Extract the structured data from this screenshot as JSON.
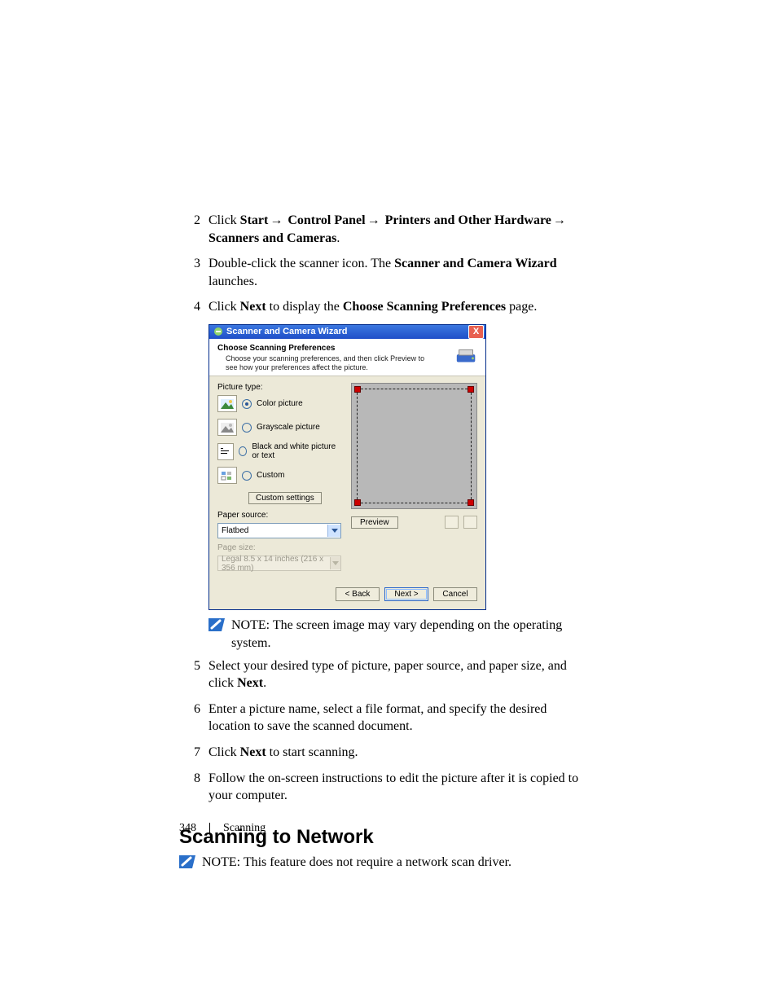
{
  "steps_top": {
    "s2": {
      "num": "2",
      "pre": "Click ",
      "b1": "Start",
      "a1": "→ ",
      "b2": "Control Panel",
      "a2": "→ ",
      "b3": "Printers and Other Hardware",
      "a3": "→ ",
      "b4": "Scanners and Cameras",
      "post": "."
    },
    "s3": {
      "num": "3",
      "pre": "Double-click the scanner icon. The ",
      "b1": "Scanner and Camera Wizard",
      "post": " launches."
    },
    "s4": {
      "num": "4",
      "pre": "Click ",
      "b1": "Next",
      "mid": " to display the ",
      "b2": "Choose Scanning Preferences",
      "post": " page."
    }
  },
  "wizard": {
    "title": "Scanner and Camera Wizard",
    "head_bold": "Choose Scanning Preferences",
    "head_sub": "Choose your scanning preferences, and then click Preview to see how your preferences affect the picture.",
    "picture_type_label": "Picture type:",
    "opt_color": "Color picture",
    "opt_gray": "Grayscale picture",
    "opt_bw": "Black and white picture or text",
    "opt_custom": "Custom",
    "custom_settings": "Custom settings",
    "paper_source_label": "Paper source:",
    "paper_source_value": "Flatbed",
    "page_size_label": "Page size:",
    "page_size_value": "Legal 8.5 x 14 inches (216 x 356 mm)",
    "preview_btn": "Preview",
    "back": "< Back",
    "next": "Next >",
    "cancel": "Cancel",
    "close": "X"
  },
  "note1": {
    "label": "NOTE:",
    "text": " The screen image may vary depending on the operating system."
  },
  "steps_bottom": {
    "s5": {
      "num": "5",
      "pre": "Select your desired type of picture, paper source, and paper size, and click ",
      "b1": "Next",
      "post": "."
    },
    "s6": {
      "num": "6",
      "text": "Enter a picture name, select a file format, and specify the desired location to save the scanned document."
    },
    "s7": {
      "num": "7",
      "pre": "Click ",
      "b1": "Next",
      "post": " to start scanning."
    },
    "s8": {
      "num": "8",
      "text": "Follow the on-screen instructions to edit the picture after it is copied to your computer."
    }
  },
  "heading": "Scanning to Network",
  "note2": {
    "label": "NOTE:",
    "text": " This feature does not require a network scan driver."
  },
  "footer": {
    "page": "348",
    "section": "Scanning"
  }
}
